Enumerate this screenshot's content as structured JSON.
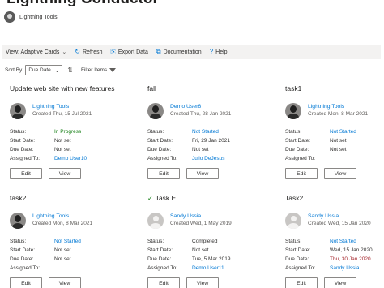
{
  "header": {
    "title": "Lightning Conductor",
    "site_name": "Lightning Tools"
  },
  "toolbar": {
    "view_label": "View: Adaptive Cards",
    "refresh_label": "Refresh",
    "export_label": "Export Data",
    "documentation_label": "Documentation",
    "help_label": "Help"
  },
  "sortbar": {
    "sort_by_label": "Sort By",
    "sort_value": "Due Date",
    "filter_label": "Filter Items"
  },
  "labels": {
    "status": "Status:",
    "start": "Start Date:",
    "due": "Due Date:",
    "assigned": "Assigned To:",
    "edit": "Edit",
    "view": "View"
  },
  "cards": [
    {
      "title": "Update web site with new features",
      "person": "Lightning Tools",
      "created": "Created Thu, 15 Jul 2021",
      "avatar": "photo",
      "status": "In Progress",
      "status_color": "#107c10",
      "start": "Not set",
      "due": "Not set",
      "assigned": "Demo User10"
    },
    {
      "title": "fall",
      "person": "Demo User6",
      "created": "Created Thu, 28 Jan 2021",
      "avatar": "photo",
      "status": "Not Started",
      "status_color": "#0078d4",
      "start": "Fri, 29 Jan 2021",
      "due": "Not set",
      "assigned": "Julio DeJesus"
    },
    {
      "title": "task1",
      "person": "Lightning Tools",
      "created": "Created Mon, 8 Mar 2021",
      "avatar": "photo",
      "status": "Not Started",
      "status_color": "#0078d4",
      "start": "Not set",
      "due": "Not set",
      "assigned": ""
    },
    {
      "title": "task2",
      "person": "Lightning Tools",
      "created": "Created Mon, 8 Mar 2021",
      "avatar": "photo",
      "status": "Not Started",
      "status_color": "#0078d4",
      "start": "Not set",
      "due": "Not set",
      "assigned": ""
    },
    {
      "title": "Task E",
      "person": "Sandy Ussia",
      "created": "Created Wed, 1 May 2019",
      "avatar": "generic",
      "status": "Completed",
      "status_color": "#323130",
      "start": "Not set",
      "due": "Tue, 5 Mar 2019",
      "assigned": "Demo User11",
      "check_icon": "checkmark-icon"
    },
    {
      "title": "Task2",
      "person": "Sandy Ussia",
      "created": "Created Wed, 15 Jan 2020",
      "avatar": "generic",
      "status": "Not Started",
      "status_color": "#0078d4",
      "start": "Wed, 15 Jan 2020",
      "due": "Thu, 30 Jan 2020",
      "assigned": "Sandy Ussia"
    }
  ],
  "colors": {
    "accent": "#0078d4",
    "overdue": "#a4262c",
    "in_progress": "#107c10"
  }
}
